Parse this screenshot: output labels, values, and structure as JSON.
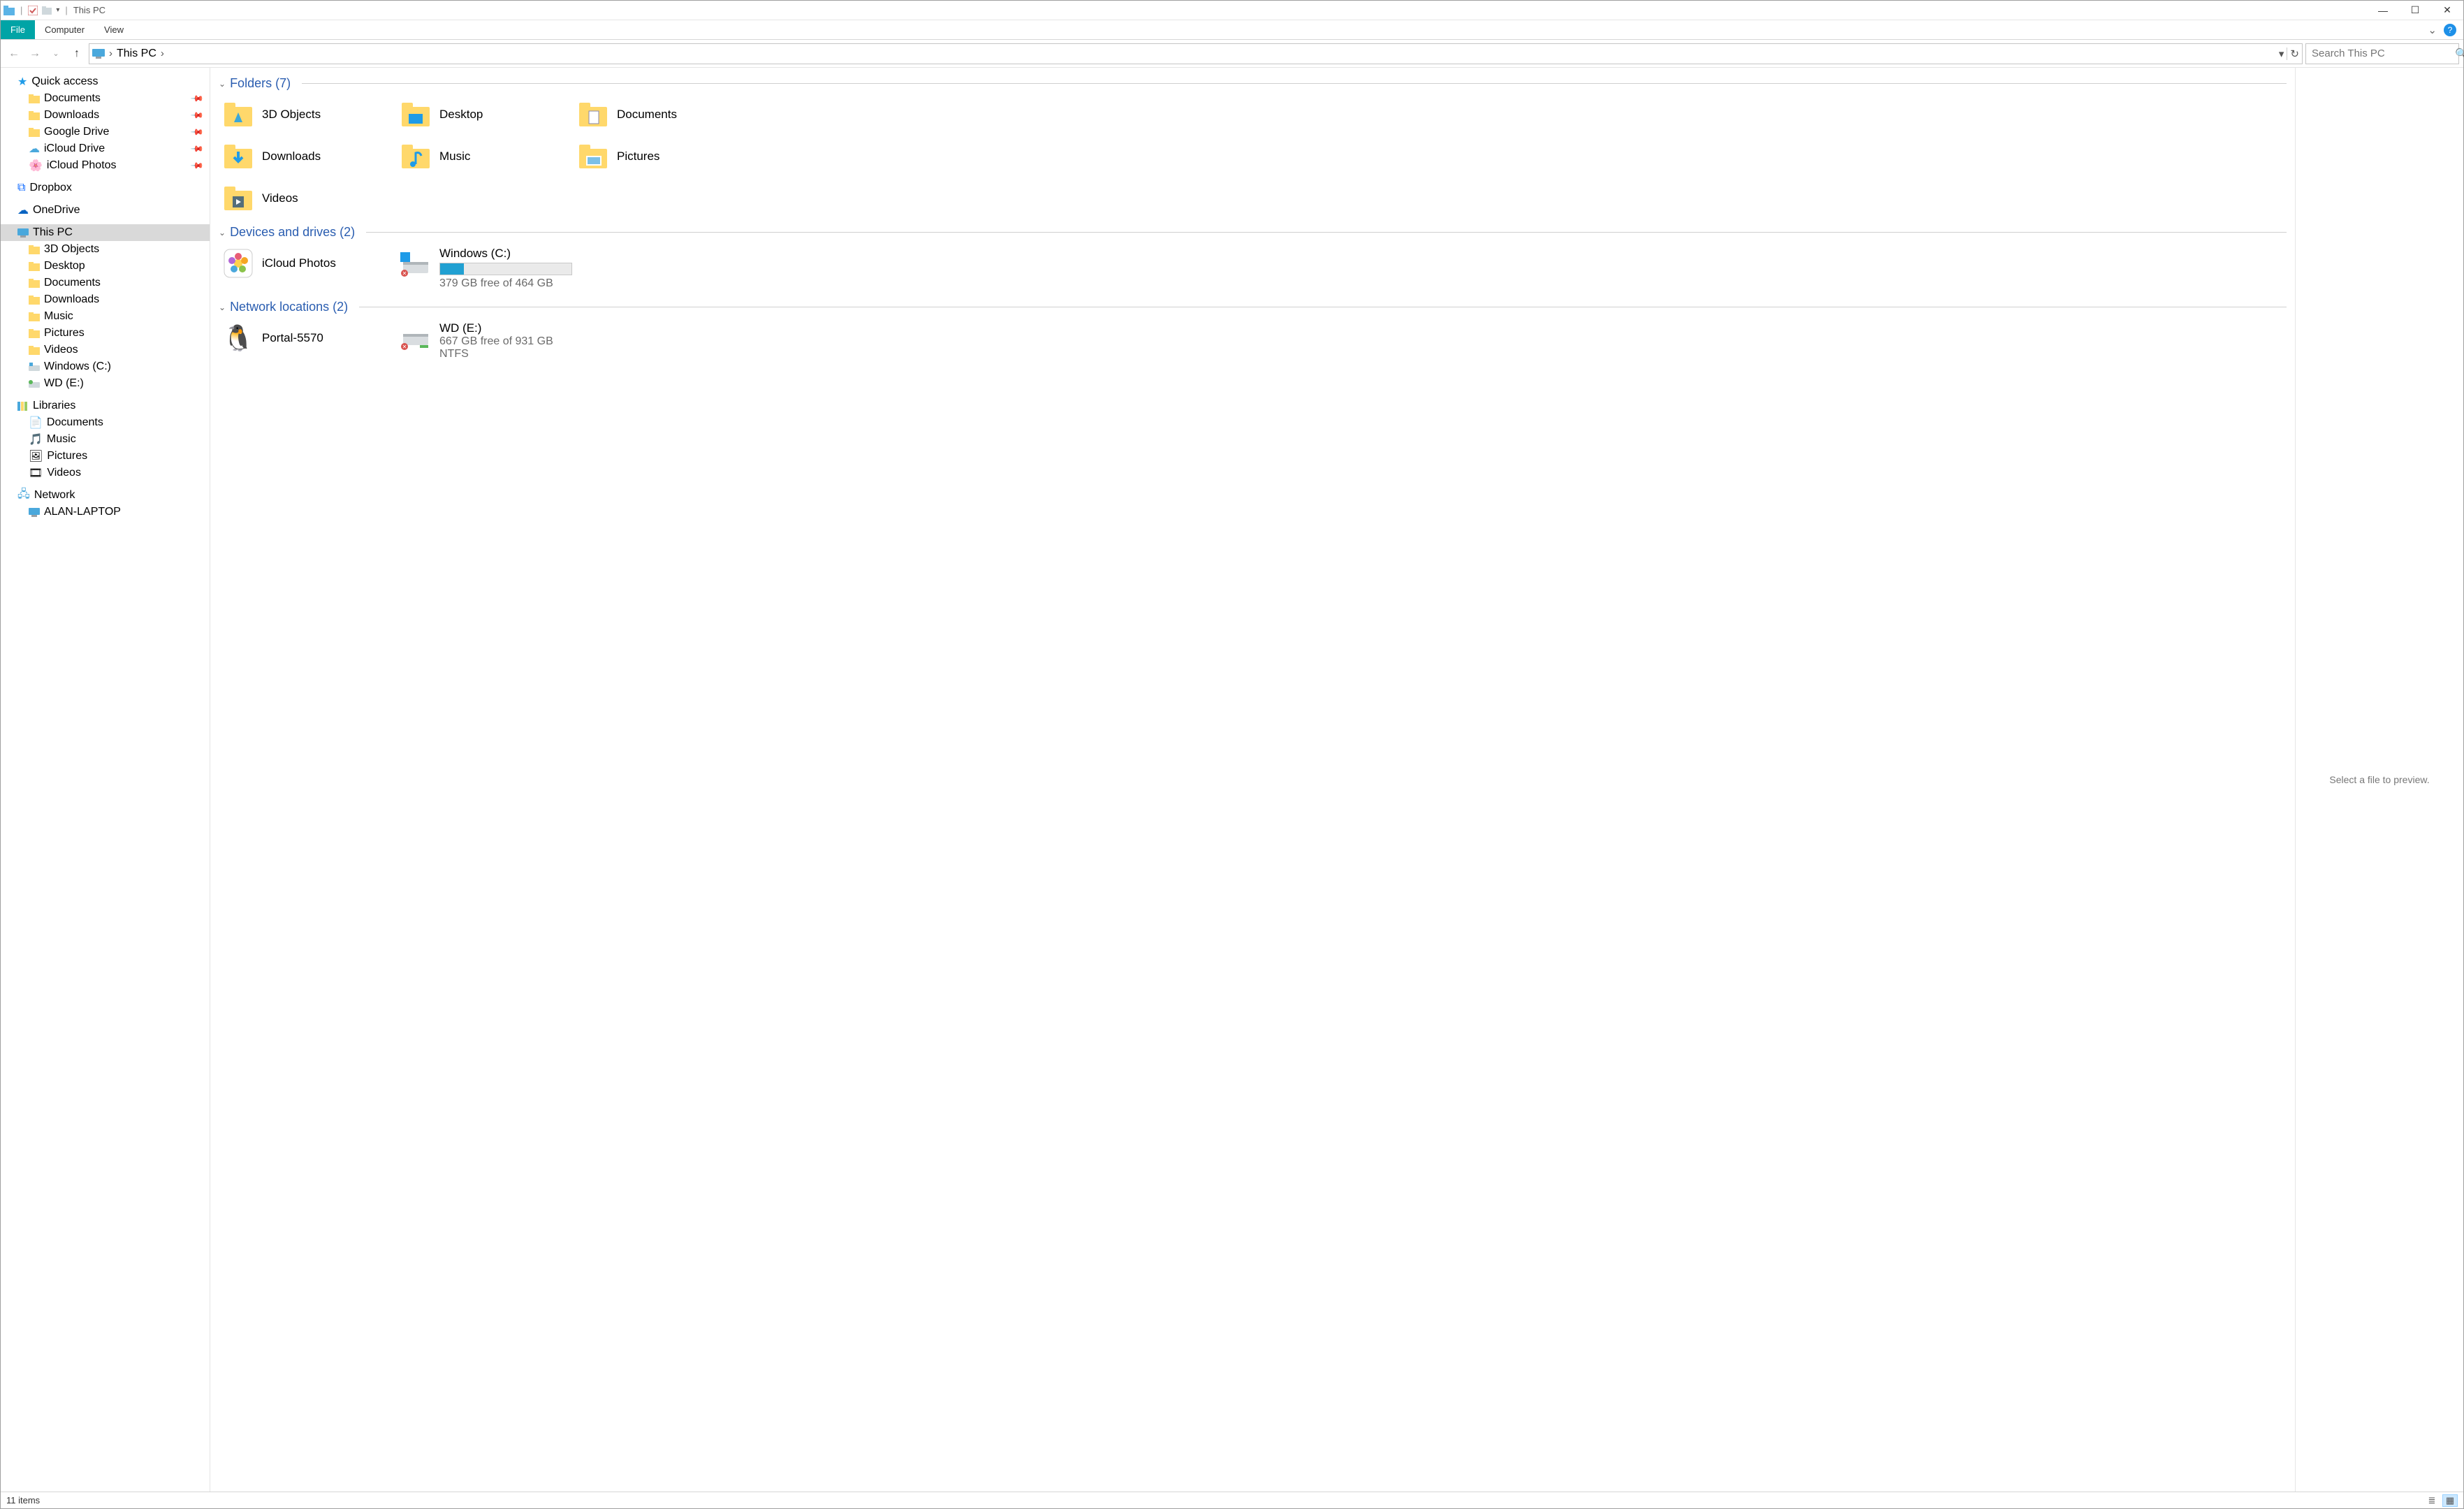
{
  "window": {
    "title": "This PC",
    "min_tooltip": "Minimize",
    "max_tooltip": "Restore Down",
    "close_tooltip": "Close"
  },
  "ribbon": {
    "file": "File",
    "computer": "Computer",
    "view": "View"
  },
  "address": {
    "location": "This PC",
    "chevron": "›",
    "dropdown": "▾",
    "refresh": "↻"
  },
  "search": {
    "placeholder": "Search This PC"
  },
  "nav": {
    "quick_access": "Quick access",
    "qa_items": [
      "Documents",
      "Downloads",
      "Google Drive",
      "iCloud Drive",
      "iCloud Photos"
    ],
    "dropbox": "Dropbox",
    "onedrive": "OneDrive",
    "this_pc": "This PC",
    "pc_items": [
      "3D Objects",
      "Desktop",
      "Documents",
      "Downloads",
      "Music",
      "Pictures",
      "Videos",
      "Windows (C:)",
      "WD (E:)"
    ],
    "libraries": "Libraries",
    "lib_items": [
      "Documents",
      "Music",
      "Pictures",
      "Videos"
    ],
    "network": "Network",
    "net_items": [
      "ALAN-LAPTOP"
    ]
  },
  "groups": {
    "folders": {
      "title": "Folders (7)",
      "items": [
        "3D Objects",
        "Desktop",
        "Documents",
        "Downloads",
        "Music",
        "Pictures",
        "Videos"
      ]
    },
    "devices": {
      "title": "Devices and drives (2)",
      "items": [
        {
          "name": "iCloud Photos",
          "kind": "app"
        },
        {
          "name": "Windows (C:)",
          "kind": "drive",
          "free_text": "379 GB free of 464 GB",
          "fill_pct": 18
        }
      ]
    },
    "network": {
      "title": "Network locations (2)",
      "items": [
        {
          "name": "Portal-5570",
          "kind": "linux"
        },
        {
          "name": "WD (E:)",
          "kind": "netdrive",
          "line1": "667 GB free of 931 GB",
          "line2": "NTFS"
        }
      ]
    }
  },
  "preview": {
    "empty": "Select a file to preview."
  },
  "status": {
    "items": "11 items"
  }
}
